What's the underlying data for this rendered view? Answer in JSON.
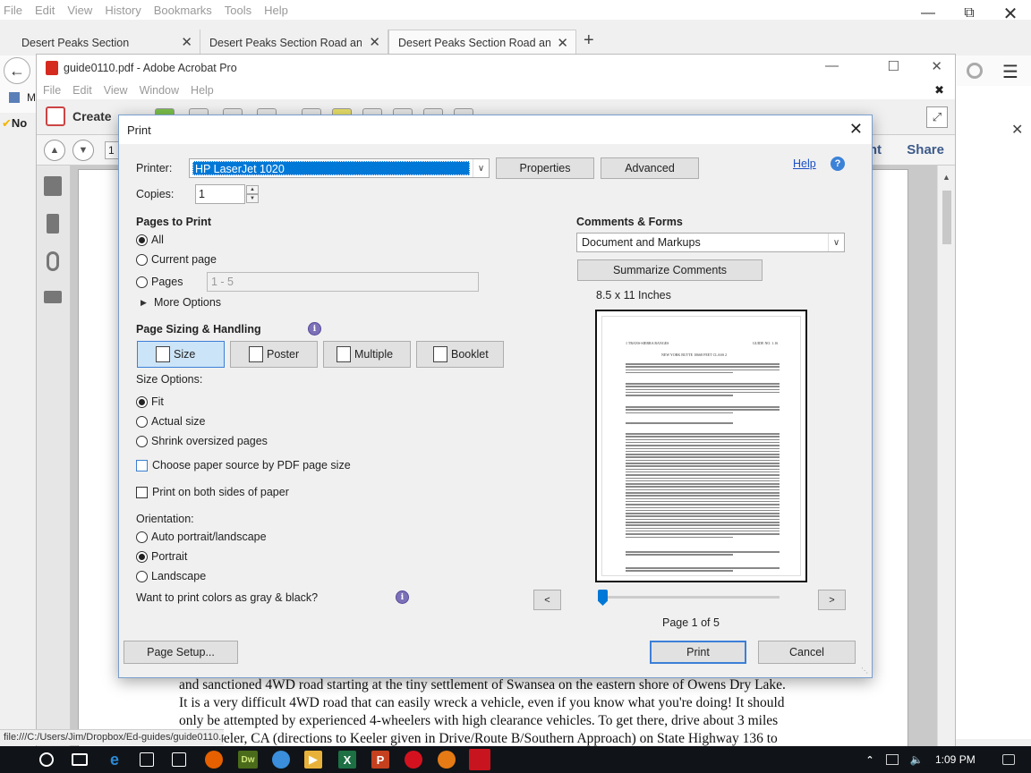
{
  "firefox": {
    "menu": [
      "File",
      "Edit",
      "View",
      "History",
      "Bookmarks",
      "Tools",
      "Help"
    ],
    "tabs": [
      {
        "label": "Desert Peaks Section"
      },
      {
        "label": "Desert Peaks Section Road and P"
      },
      {
        "label": "Desert Peaks Section Road and P"
      }
    ],
    "status_url": "file:///C:/Users/Jim/Dropbox/Ed-guides/guide0110.pdf",
    "bookmarks_partial": "M",
    "norton_partial": "No"
  },
  "acrobat": {
    "title": "guide0110.pdf - Adobe Acrobat Pro",
    "menu": [
      "File",
      "Edit",
      "View",
      "Window",
      "Help"
    ],
    "create_label": "Create",
    "share_label": "Share",
    "print_partial": "nt",
    "page_field": "1",
    "doc_text": [
      "and sanctioned 4WD road starting at the tiny settlement of Swansea on the eastern shore of Owens Dry Lake.",
      "It is a very difficult 4WD road that can easily wreck a vehicle, even if you know what you're doing!  It should",
      "only be attempted by experienced 4-wheelers with high clearance vehicles.  To get there, drive about 3 miles",
      "N of Keeler, CA (directions to Keeler given in Drive/Route B/Southern Approach) on State Highway 136 to"
    ]
  },
  "dialog": {
    "title": "Print",
    "printer_label": "Printer:",
    "printer_value": "HP LaserJet 1020",
    "properties_label": "Properties",
    "advanced_label": "Advanced",
    "help_label": "Help",
    "copies_label": "Copies:",
    "copies_value": "1",
    "pages_to_print": {
      "header": "Pages to Print",
      "all": "All",
      "current": "Current page",
      "pages": "Pages",
      "pages_range": "1 - 5",
      "more_options": "More Options",
      "selected": "All"
    },
    "sizing": {
      "header": "Page Sizing & Handling",
      "tabs": [
        "Size",
        "Poster",
        "Multiple",
        "Booklet"
      ],
      "selected_tab": "Size",
      "size_options_label": "Size Options:",
      "fit": "Fit",
      "actual": "Actual size",
      "shrink": "Shrink oversized pages",
      "paper_source": "Choose paper source by PDF page size",
      "both_sides": "Print on both sides of paper"
    },
    "orientation": {
      "label": "Orientation:",
      "auto": "Auto portrait/landscape",
      "portrait": "Portrait",
      "landscape": "Landscape",
      "selected": "Portrait"
    },
    "gray_question": "Want to print colors as gray & black?",
    "comments_forms": {
      "header": "Comments & Forms",
      "value": "Document and Markups",
      "summarize": "Summarize Comments"
    },
    "preview": {
      "paper_size": "8.5 x 11 Inches",
      "page_status": "Page 1 of 5",
      "page_current": 1,
      "page_total": 5,
      "heading_left": "1    TRANS-SIERRA RANGES",
      "heading_right": "GUIDE NO. 1.16",
      "peak_title": "NEW YORK BUTTE   10668 FEET   CLASS 2"
    },
    "page_setup_label": "Page Setup...",
    "print_label": "Print",
    "cancel_label": "Cancel"
  },
  "taskbar": {
    "time": "1:09 PM",
    "apps": [
      "Dw",
      "X",
      "P"
    ]
  }
}
